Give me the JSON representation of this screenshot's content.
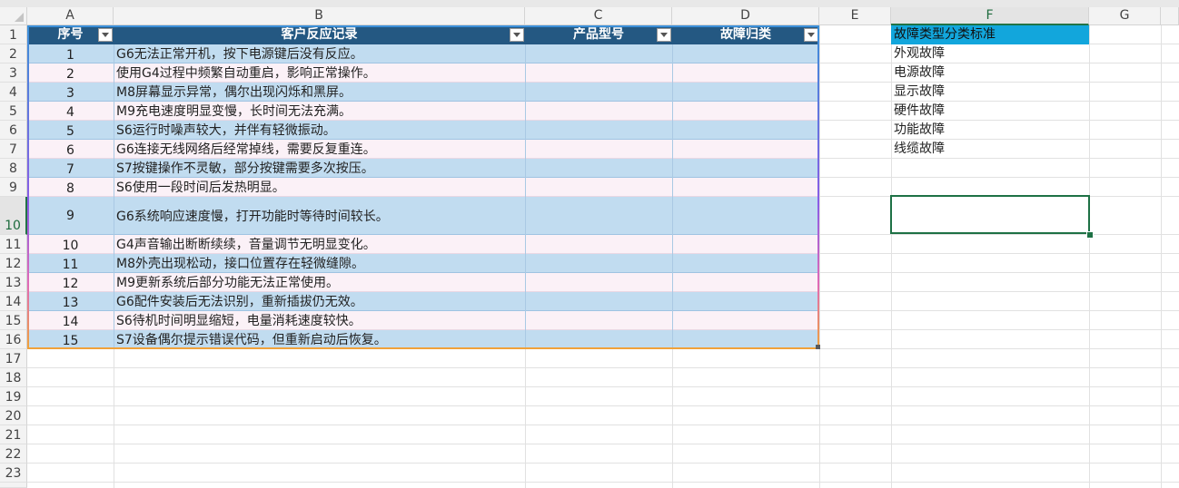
{
  "columns": [
    "A",
    "B",
    "C",
    "D",
    "E",
    "F",
    "G"
  ],
  "selected_column": "F",
  "rows": [
    "1",
    "2",
    "3",
    "4",
    "5",
    "6",
    "7",
    "8",
    "9",
    "10",
    "11",
    "12",
    "13",
    "14",
    "15",
    "16",
    "17",
    "18",
    "19",
    "20",
    "21",
    "22",
    "23"
  ],
  "selected_row": "10",
  "table": {
    "headers": [
      "序号",
      "客户反应记录",
      "产品型号",
      "故障归类"
    ],
    "records": [
      {
        "no": "1",
        "text": "G6无法正常开机，按下电源键后没有反应。"
      },
      {
        "no": "2",
        "text": "使用G4过程中频繁自动重启，影响正常操作。"
      },
      {
        "no": "3",
        "text": "M8屏幕显示异常，偶尔出现闪烁和黑屏。"
      },
      {
        "no": "4",
        "text": "M9充电速度明显变慢，长时间无法充满。"
      },
      {
        "no": "5",
        "text": "S6运行时噪声较大，并伴有轻微振动。"
      },
      {
        "no": "6",
        "text": "G6连接无线网络后经常掉线，需要反复重连。"
      },
      {
        "no": "7",
        "text": "S7按键操作不灵敏，部分按键需要多次按压。"
      },
      {
        "no": "8",
        "text": "S6使用一段时间后发热明显。"
      },
      {
        "no": "9",
        "text": "G6系统响应速度慢，打开功能时等待时间较长。"
      },
      {
        "no": "10",
        "text": "G4声音输出断断续续，音量调节无明显变化。"
      },
      {
        "no": "11",
        "text": "M8外壳出现松动，接口位置存在轻微缝隙。"
      },
      {
        "no": "12",
        "text": "M9更新系统后部分功能无法正常使用。"
      },
      {
        "no": "13",
        "text": "G6配件安装后无法识别，重新插拔仍无效。"
      },
      {
        "no": "14",
        "text": "S6待机时间明显缩短，电量消耗速度较快。"
      },
      {
        "no": "15",
        "text": "S7设备偶尔提示错误代码，但重新启动后恢复。"
      }
    ]
  },
  "categories": {
    "header": "故障类型分类标准",
    "items": [
      "外观故障",
      "电源故障",
      "显示故障",
      "硬件故障",
      "功能故障",
      "线缆故障"
    ]
  },
  "colors": {
    "table_header": "#245882",
    "band_blue": "#c1dcf0",
    "band_pink": "#fbf1f7",
    "category_header": "#12a6dc",
    "selection": "#1e7145"
  }
}
